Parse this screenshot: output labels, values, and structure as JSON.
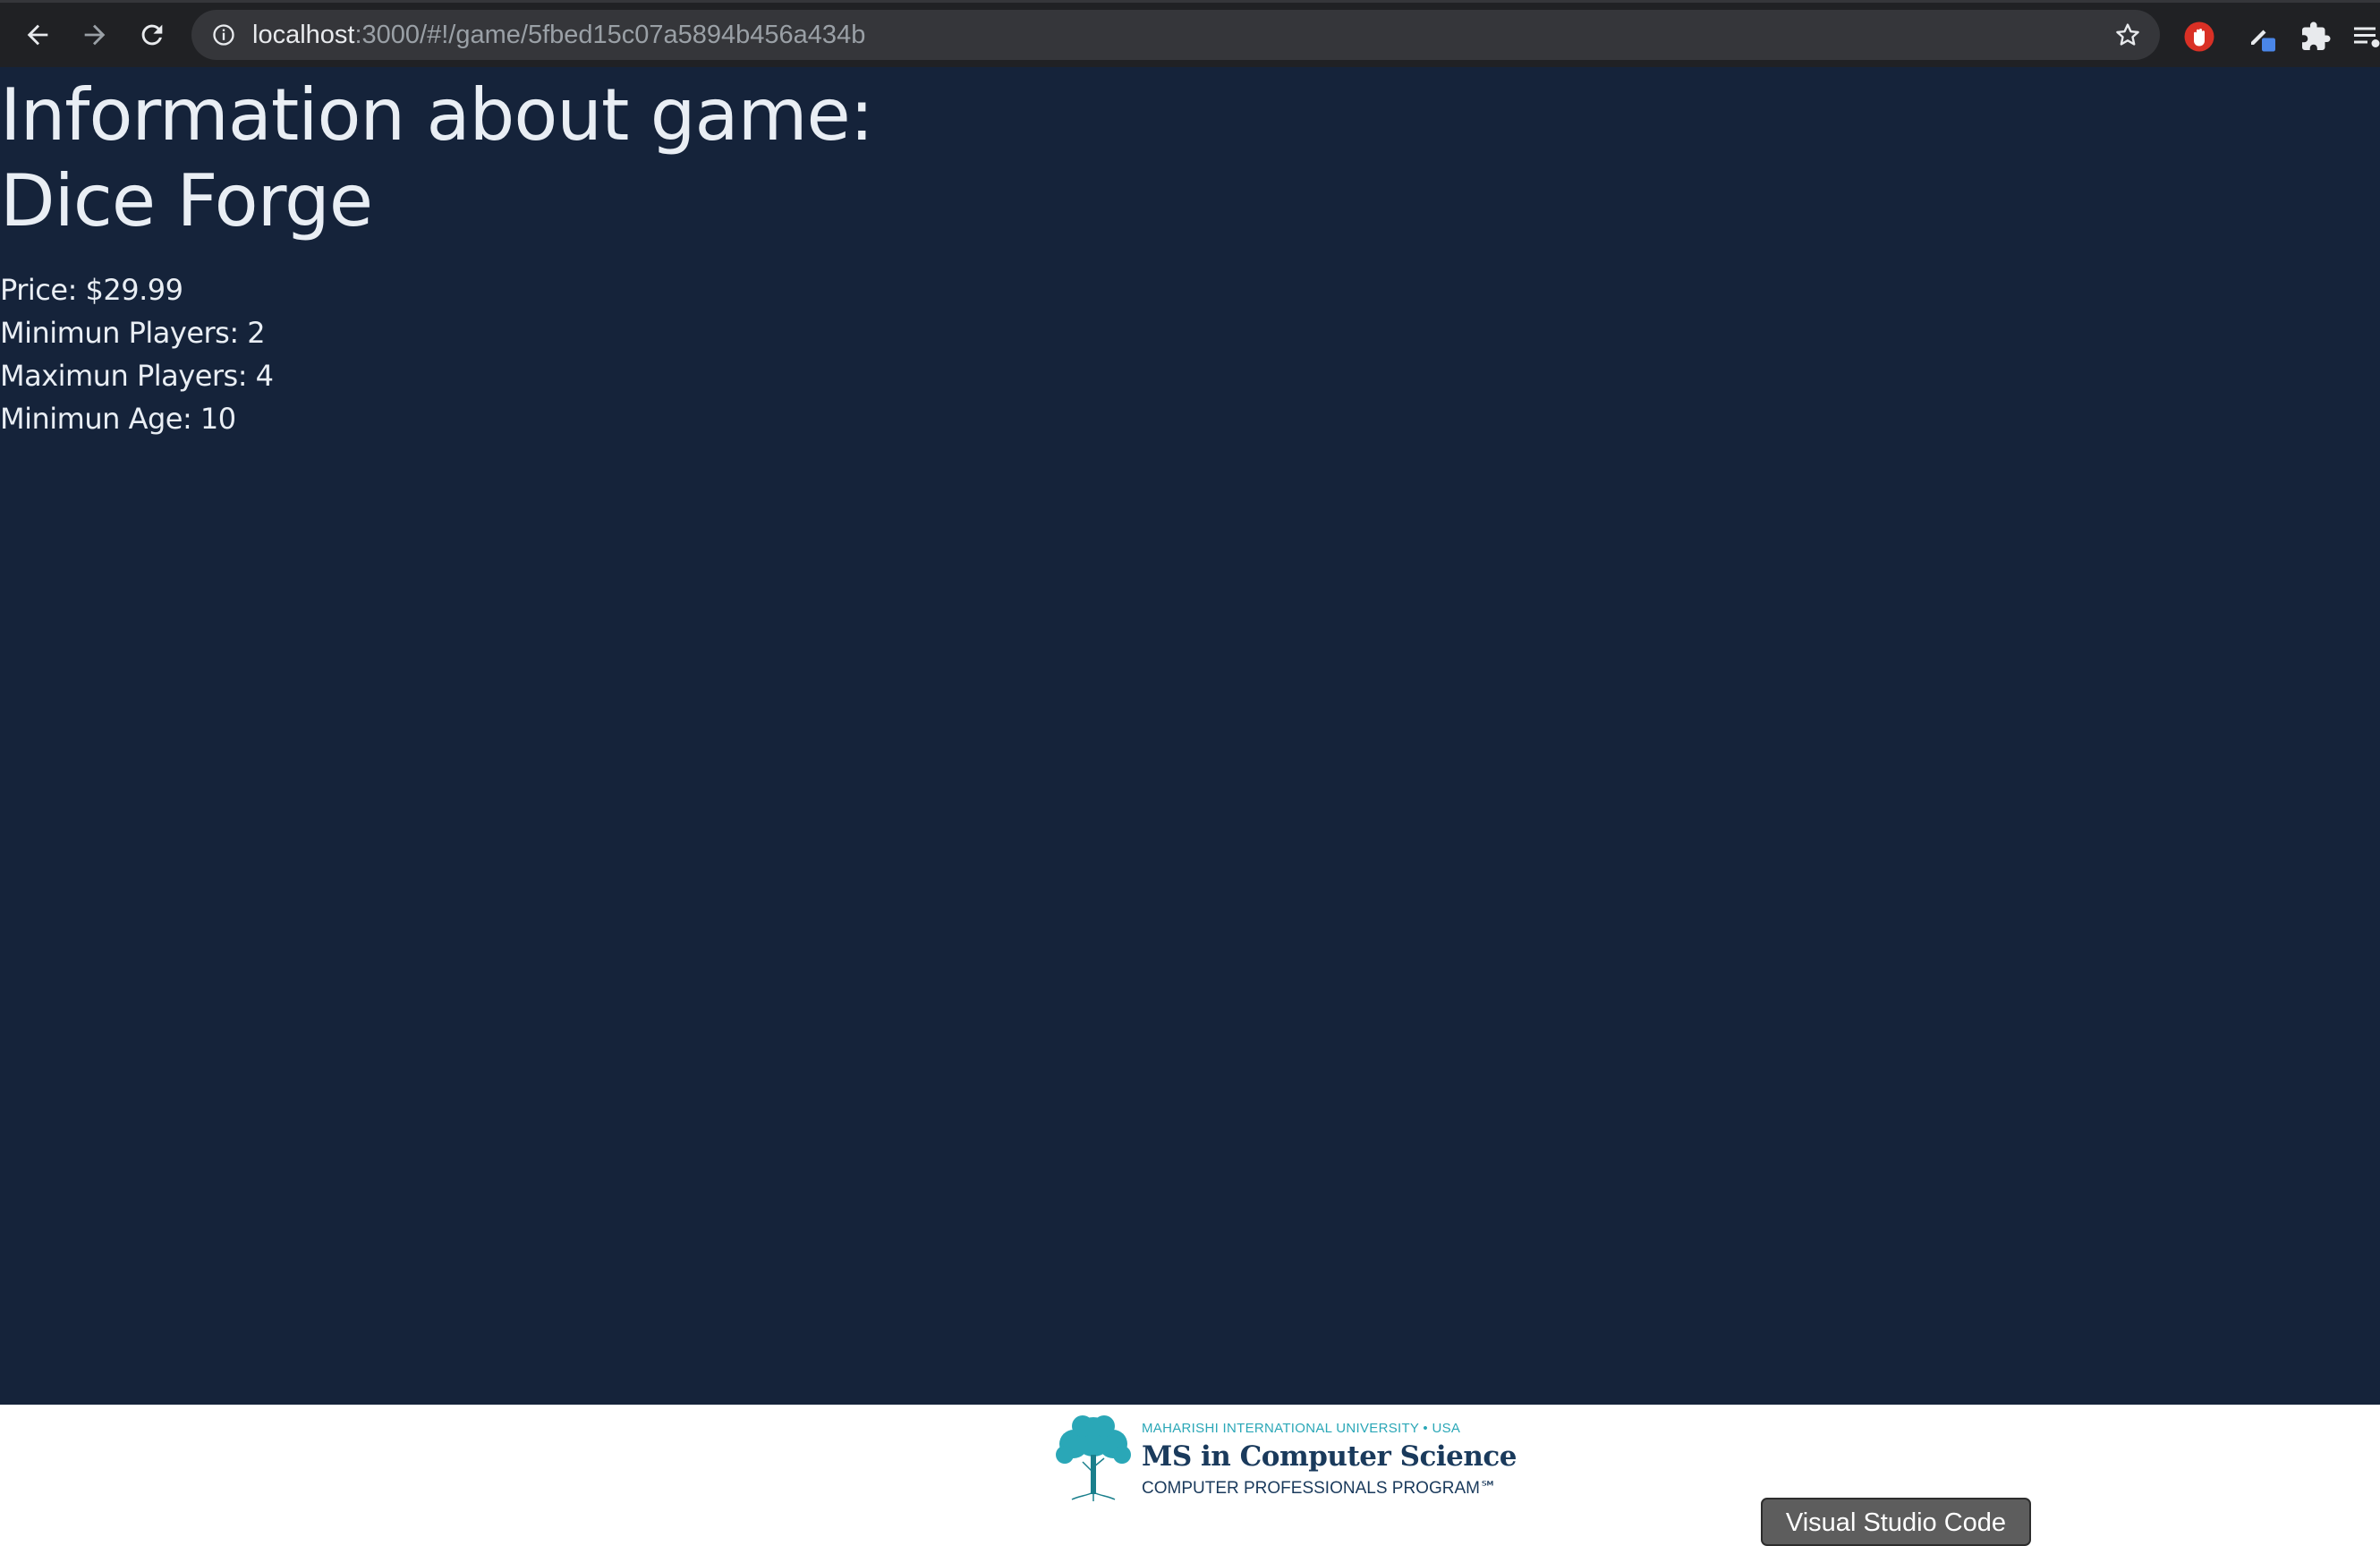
{
  "browser": {
    "url_host": "localhost",
    "url_rest": ":3000/#!/game/5fbed15c07a5894b456a434b",
    "icons": [
      "back-arrow-icon",
      "forward-arrow-icon",
      "reload-icon",
      "info-icon",
      "star-icon",
      "stop-hand-extension-icon",
      "pen-extension-icon",
      "puzzle-extension-icon",
      "reading-list-icon"
    ]
  },
  "page": {
    "heading_line1": "Information about game:",
    "heading_line2": "Dice Forge",
    "price": "Price: $29.99",
    "min_players": "Minimun Players: 2",
    "max_players": "Maximun Players: 4",
    "min_age": "Minimun Age: 10"
  },
  "footer": {
    "logo_line1": "MAHARISHI INTERNATIONAL UNIVERSITY • USA",
    "logo_line2": "MS in Computer Science",
    "logo_line3": "COMPUTER PROFESSIONALS PROGRAM℠",
    "button_label": "Visual Studio Code"
  },
  "colors": {
    "page_background": "#15233a",
    "text": "#e9eef4",
    "browser_bar": "#202124",
    "omnibox": "#35363a",
    "logo_teal": "#2aa7b7",
    "logo_navy": "#1a3a5c"
  }
}
